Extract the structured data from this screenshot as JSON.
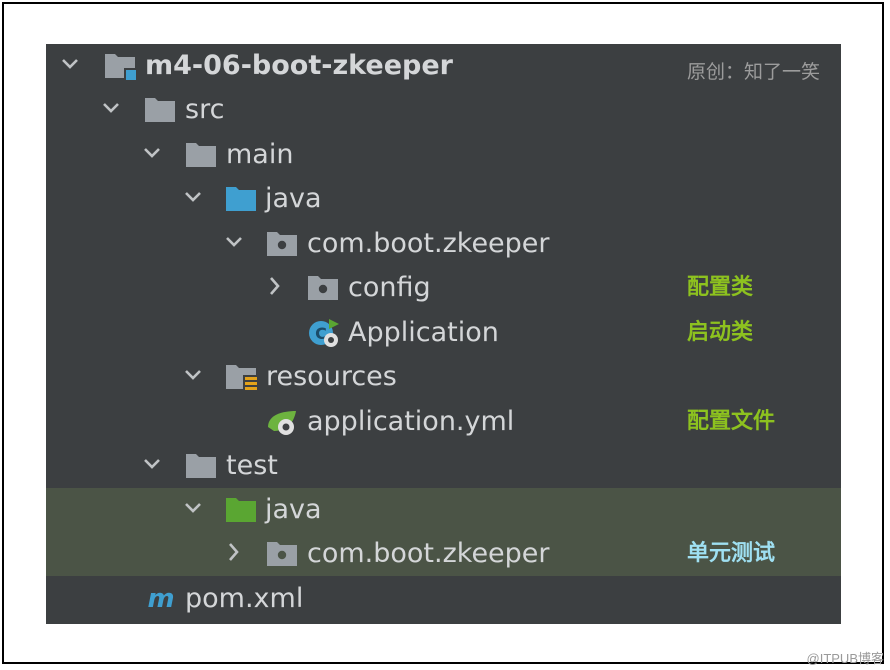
{
  "author": "原创：知了一笑",
  "watermark": "@ITPUB博客",
  "tree": [
    {
      "label": "m4-06-boot-zkeeper",
      "icon": "module-folder-icon",
      "state": "expanded"
    },
    {
      "label": "src",
      "icon": "folder-icon",
      "state": "expanded"
    },
    {
      "label": "main",
      "icon": "folder-icon",
      "state": "expanded"
    },
    {
      "label": "java",
      "icon": "source-folder-icon",
      "state": "expanded"
    },
    {
      "label": "com.boot.zkeeper",
      "icon": "package-icon",
      "state": "expanded"
    },
    {
      "label": "config",
      "icon": "package-icon",
      "state": "collapsed",
      "note": "配置类"
    },
    {
      "label": "Application",
      "icon": "spring-boot-app-icon",
      "state": "leaf",
      "note": "启动类"
    },
    {
      "label": "resources",
      "icon": "resources-folder-icon",
      "state": "expanded"
    },
    {
      "label": "application.yml",
      "icon": "spring-config-icon",
      "state": "leaf",
      "note": "配置文件"
    },
    {
      "label": "test",
      "icon": "folder-icon",
      "state": "expanded"
    },
    {
      "label": "java",
      "icon": "test-source-folder-icon",
      "state": "expanded"
    },
    {
      "label": "com.boot.zkeeper",
      "icon": "package-icon",
      "state": "collapsed",
      "note": "单元测试"
    },
    {
      "label": "pom.xml",
      "icon": "maven-icon",
      "state": "leaf"
    }
  ],
  "colors": {
    "panel_bg": "#3c3f41",
    "highlight_bg": "#4b5446",
    "text": "#d4d6d8",
    "note_green": "#8dc21f",
    "note_cyan": "#9fe0f2",
    "folder_gray": "#9aa0a6",
    "source_blue": "#3f9fd0",
    "test_green": "#5aa632"
  }
}
